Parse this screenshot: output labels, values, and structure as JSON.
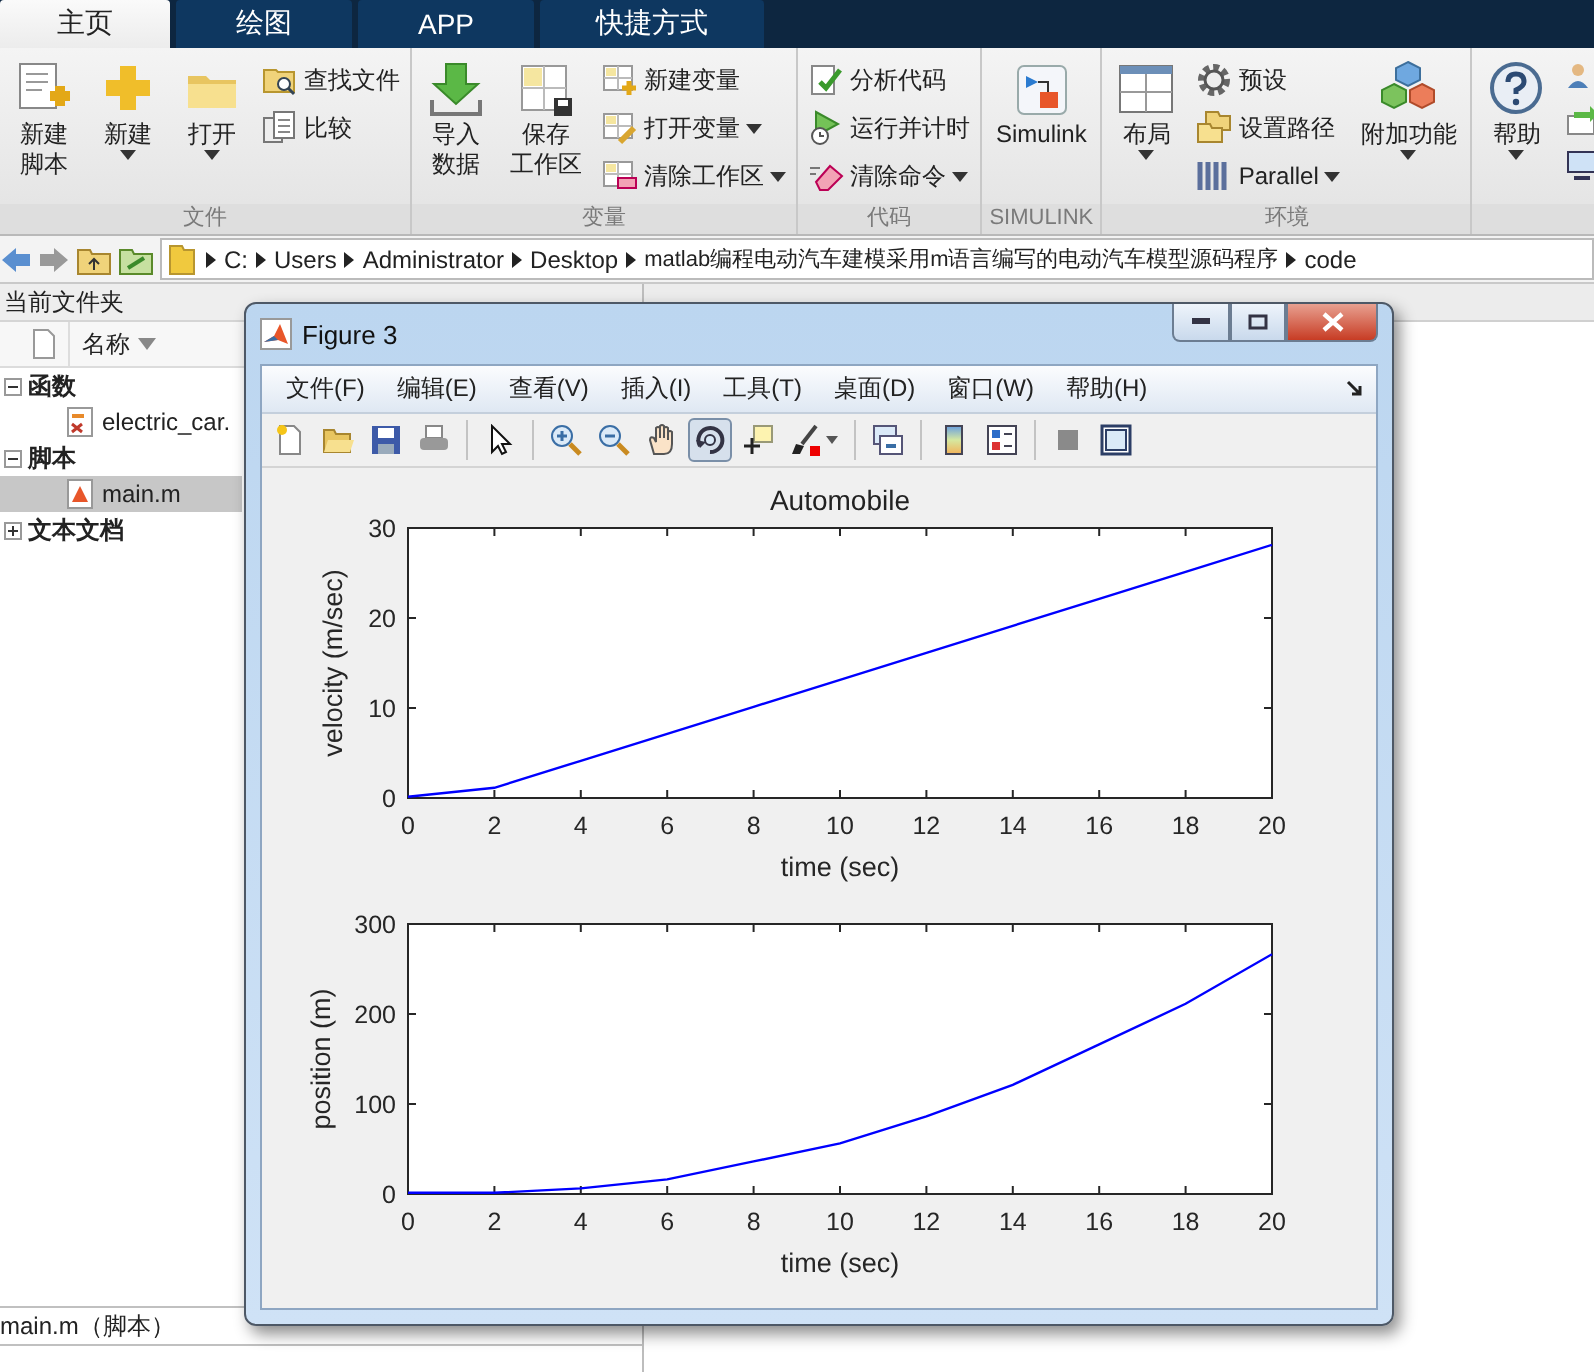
{
  "tabs": [
    {
      "label": "主页",
      "selected": true
    },
    {
      "label": "绘图",
      "selected": false
    },
    {
      "label": "APP",
      "selected": false
    },
    {
      "label": "快捷方式",
      "selected": false
    }
  ],
  "toolstrip": {
    "groups": [
      {
        "label": "文件",
        "items": [
          {
            "kind": "large",
            "lines": [
              "新建",
              "脚本"
            ],
            "dropdown": false
          },
          {
            "kind": "large",
            "lines": [
              "新建"
            ],
            "dropdown": true
          },
          {
            "kind": "large",
            "lines": [
              "打开"
            ],
            "dropdown": true
          },
          {
            "kind": "small_stack",
            "entries": [
              {
                "label": "查找文件",
                "dropdown": false
              },
              {
                "label": "比较",
                "dropdown": false
              }
            ]
          }
        ]
      },
      {
        "label": "变量",
        "items": [
          {
            "kind": "large",
            "lines": [
              "导入",
              "数据"
            ],
            "dropdown": false
          },
          {
            "kind": "large",
            "lines": [
              "保存",
              "工作区"
            ],
            "dropdown": false
          },
          {
            "kind": "small_stack",
            "entries": [
              {
                "label": "新建变量",
                "dropdown": false
              },
              {
                "label": "打开变量",
                "dropdown": true
              },
              {
                "label": "清除工作区",
                "dropdown": true
              }
            ]
          }
        ]
      },
      {
        "label": "代码",
        "items": [
          {
            "kind": "small_stack",
            "entries": [
              {
                "label": "分析代码",
                "dropdown": false
              },
              {
                "label": "运行并计时",
                "dropdown": false
              },
              {
                "label": "清除命令",
                "dropdown": true
              }
            ]
          }
        ]
      },
      {
        "label": "SIMULINK",
        "items": [
          {
            "kind": "large",
            "lines": [
              "Simulink"
            ],
            "dropdown": false
          }
        ]
      },
      {
        "label": "环境",
        "items": [
          {
            "kind": "large",
            "lines": [
              "布局"
            ],
            "dropdown": true
          },
          {
            "kind": "small_stack",
            "entries": [
              {
                "label": "预设",
                "dropdown": false
              },
              {
                "label": "设置路径",
                "dropdown": false
              },
              {
                "label": "Parallel",
                "dropdown": true
              }
            ]
          },
          {
            "kind": "large",
            "lines": [
              "附加功能"
            ],
            "dropdown": true
          }
        ]
      },
      {
        "items": [
          {
            "kind": "large",
            "lines": [
              "帮助"
            ],
            "dropdown": true
          },
          {
            "kind": "icon_stack"
          }
        ]
      }
    ]
  },
  "address_bar": {
    "path": [
      "C:",
      "Users",
      "Administrator",
      "Desktop",
      "matlab编程电动汽车建模采用m语言编写的电动汽车模型源码程序",
      "code"
    ]
  },
  "current_folder": {
    "title": "当前文件夹",
    "column": "名称",
    "tree": [
      {
        "label": "函数",
        "expanded": true,
        "selected": false,
        "children": [
          {
            "label": "electric_car.",
            "kind": "function",
            "selected": false
          }
        ]
      },
      {
        "label": "脚本",
        "expanded": true,
        "selected": false,
        "children": [
          {
            "label": "main.m",
            "kind": "script",
            "selected": true
          }
        ]
      },
      {
        "label": "文本文档",
        "expanded": false,
        "selected": false
      }
    ],
    "details": "main.m（脚本）"
  },
  "figure": {
    "title": "Figure 3",
    "menu": [
      "文件(F)",
      "编辑(E)",
      "查看(V)",
      "插入(I)",
      "工具(T)",
      "桌面(D)",
      "窗口(W)",
      "帮助(H)"
    ],
    "toolbar": [
      {
        "selected": false
      },
      {
        "selected": false
      },
      {
        "selected": false
      },
      {
        "selected": false
      },
      {
        "selected": false
      },
      {
        "selected": false
      },
      {
        "selected": false
      },
      {
        "selected": false
      },
      {
        "selected": true
      },
      {
        "selected": false
      },
      {
        "selected": false
      },
      {
        "selected": false
      },
      {
        "selected": false
      },
      {
        "selected": false
      },
      {
        "selected": false
      },
      {
        "selected": false
      }
    ],
    "charts": [
      {
        "chart_data": {
          "type": "line",
          "title": "Automobile",
          "xlabel": "time (sec)",
          "ylabel": "velocity (m/sec)",
          "x": [
            0,
            2,
            4,
            6,
            8,
            10,
            12,
            14,
            16,
            18,
            20
          ],
          "series": [
            {
              "color": "#0000ff",
              "values": [
                0,
                1,
                4,
                7,
                10,
                13,
                16,
                19,
                22,
                25,
                28
              ]
            }
          ],
          "xlim": [
            0,
            20
          ],
          "ylim": [
            0,
            30
          ],
          "xticks": [
            0,
            2,
            4,
            6,
            8,
            10,
            12,
            14,
            16,
            18,
            20
          ],
          "yticks": [
            0,
            10,
            20,
            30
          ]
        }
      },
      {
        "chart_data": {
          "type": "line",
          "xlabel": "time (sec)",
          "ylabel": "position (m)",
          "x": [
            0,
            2,
            4,
            6,
            8,
            10,
            12,
            14,
            16,
            18,
            20
          ],
          "series": [
            {
              "color": "#0000ff",
              "values": [
                0,
                0,
                5,
                15,
                35,
                55,
                85,
                120,
                165,
                210,
                265
              ]
            }
          ],
          "xlim": [
            0,
            20
          ],
          "ylim": [
            0,
            300
          ],
          "xticks": [
            0,
            2,
            4,
            6,
            8,
            10,
            12,
            14,
            16,
            18,
            20
          ],
          "yticks": [
            0,
            100,
            200,
            300
          ]
        }
      }
    ]
  }
}
